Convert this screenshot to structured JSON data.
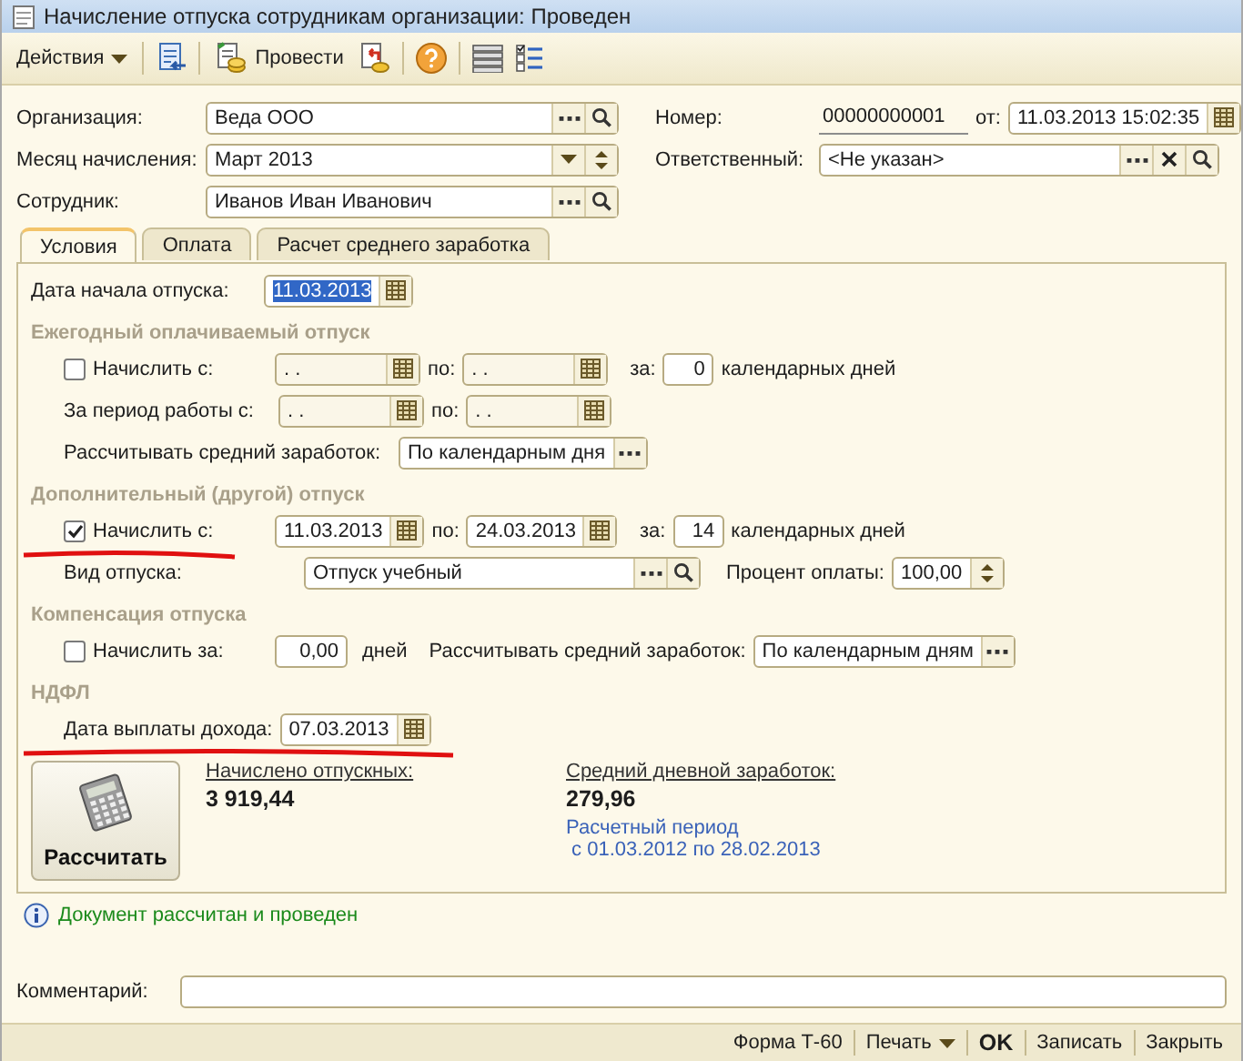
{
  "window": {
    "title": "Начисление отпуска сотрудникам организации: Проведен"
  },
  "toolbar": [
    {
      "kind": "menu",
      "label": "Действия"
    },
    {
      "kind": "separator"
    },
    {
      "kind": "form"
    },
    {
      "kind": "separator"
    },
    {
      "kind": "post",
      "label": "Провести"
    },
    {
      "kind": "unpost"
    },
    {
      "kind": "separator"
    },
    {
      "kind": "help"
    },
    {
      "kind": "separator"
    },
    {
      "kind": "table"
    },
    {
      "kind": "checklist"
    }
  ],
  "header": {
    "organization": {
      "label": "Организация:",
      "value": "Веда ООО"
    },
    "month": {
      "label": "Месяц начисления:",
      "value": "Март 2013"
    },
    "employee": {
      "label": "Сотрудник:",
      "value": "Иванов Иван Иванович"
    },
    "number": {
      "label": "Номер:",
      "value": "00000000001"
    },
    "date": {
      "label": "от:",
      "value": "11.03.2013 15:02:35"
    },
    "responsible": {
      "label": "Ответственный:",
      "value": "<Не указан>"
    }
  },
  "tabs": [
    {
      "label": "Условия",
      "selected": true
    },
    {
      "label": "Оплата",
      "selected": false
    },
    {
      "label": "Расчет среднего заработка",
      "selected": false
    }
  ],
  "start_date": {
    "label": "Дата начала отпуска:",
    "value": "11.03.2013",
    "selected": true
  },
  "annual": {
    "title": "Ежегодный оплачиваемый отпуск",
    "disabled": true,
    "accrue": {
      "label": "Начислить с:",
      "checked": false,
      "from": " .  .",
      "to_label": "по:",
      "to": " .  .",
      "days_label": "за:",
      "days": "0",
      "unit": "календарных дней"
    },
    "period": {
      "label": "За период работы с:",
      "from": " .  .",
      "to_label": "по:",
      "to": " .  ."
    },
    "average": {
      "label": "Рассчитывать средний заработок:",
      "value": "По календарным дня"
    }
  },
  "additional": {
    "title": "Дополнительный (другой) отпуск",
    "disabled": false,
    "accrue": {
      "label": "Начислить с:",
      "checked": true,
      "highlight": true,
      "from": "11.03.2013",
      "to_label": "по:",
      "to": "24.03.2013",
      "days_label": "за:",
      "days": "14",
      "unit": "календарных дней"
    },
    "type": {
      "label": "Вид отпуска:",
      "value": "Отпуск учебный"
    },
    "percent": {
      "label": "Процент оплаты:",
      "value": "100,00"
    }
  },
  "compensation": {
    "title": "Компенсация отпуска",
    "accrue": {
      "label": "Начислить за:",
      "checked": false,
      "value": "0,00",
      "unit": "дней"
    },
    "average": {
      "label": "Рассчитывать средний заработок:",
      "value": "По календарным дням"
    }
  },
  "ndfl": {
    "title": "НДФЛ",
    "pay_date": {
      "label": "Дата выплаты дохода:",
      "value": "07.03.2013",
      "highlight": true
    }
  },
  "calculate_button": "Рассчитать",
  "results": {
    "accrued": {
      "label": "Начислено отпускных:",
      "value": "3 919,44"
    },
    "daily": {
      "label": "Средний дневной заработок:",
      "value": "279,96"
    },
    "period": {
      "title": "Расчетный период",
      "value": " с 01.03.2012 по 28.02.2013"
    }
  },
  "info": "Документ рассчитан и проведен",
  "comment": {
    "label": "Комментарий:"
  },
  "footer": [
    {
      "kind": "link",
      "label": "Форма Т-60"
    },
    {
      "kind": "menu",
      "label": "Печать"
    },
    {
      "kind": "default",
      "label": "OK"
    },
    {
      "kind": "link",
      "label": "Записать"
    },
    {
      "kind": "link",
      "label": "Закрыть"
    }
  ]
}
